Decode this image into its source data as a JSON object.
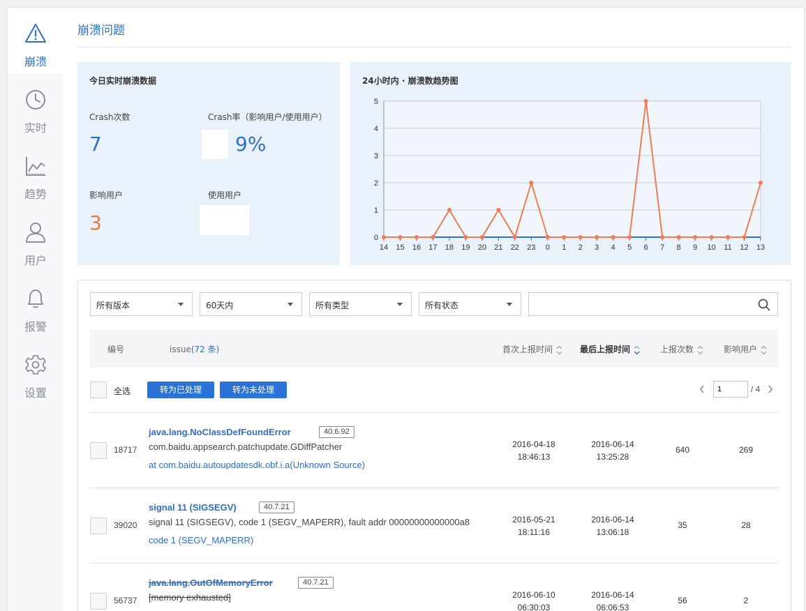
{
  "sidebar": {
    "items": [
      {
        "label": "崩溃",
        "icon": "warning-icon",
        "active": true
      },
      {
        "label": "实时",
        "icon": "clock-icon"
      },
      {
        "label": "趋势",
        "icon": "trend-chart-icon"
      },
      {
        "label": "用户",
        "icon": "user-icon"
      },
      {
        "label": "报警",
        "icon": "bell-icon"
      },
      {
        "label": "设置",
        "icon": "gear-icon"
      }
    ]
  },
  "page": {
    "title": "崩溃问题"
  },
  "today": {
    "title": "今日实时崩溃数据",
    "crash_count_label": "Crash次数",
    "crash_count": "7",
    "crash_rate_label": "Crash率（影响用户/使用用户）",
    "crash_rate": "9%",
    "affected_users_label": "影响用户",
    "affected_users": "3",
    "active_users_label": "使用用户"
  },
  "chart_data": {
    "type": "line",
    "title": "24小时内 · 崩溃数趋势图",
    "categories": [
      "14",
      "15",
      "16",
      "17",
      "18",
      "19",
      "20",
      "21",
      "22",
      "23",
      "0",
      "1",
      "2",
      "3",
      "4",
      "5",
      "6",
      "7",
      "8",
      "9",
      "10",
      "11",
      "12",
      "13"
    ],
    "values": [
      0,
      0,
      0,
      0,
      1,
      0,
      0,
      1,
      0,
      2,
      0,
      0,
      0,
      0,
      0,
      0,
      5,
      0,
      0,
      0,
      0,
      0,
      0,
      2
    ],
    "ylim": [
      0,
      5
    ],
    "yticks": [
      "0",
      "1",
      "2",
      "3",
      "4",
      "5"
    ],
    "grid": true,
    "line_color": "#f37b52",
    "axis_color": "#2f6fcd"
  },
  "filters": {
    "version": "所有版本",
    "range": "60天内",
    "type": "所有类型",
    "status": "所有状态",
    "search_value": ""
  },
  "table": {
    "headers": {
      "id": "编号",
      "issue": "issue",
      "issue_count": "(72 条)",
      "first_time": "首次上报时间",
      "last_time": "最后上报时间",
      "reports": "上报次数",
      "users": "影响用户"
    },
    "select_all": "全选",
    "mark_processed": "转为已处理",
    "mark_unprocessed": "转为未处理",
    "page_current": "1",
    "page_total": "/ 4",
    "rows": [
      {
        "id": "18717",
        "title": "java.lang.NoClassDefFoundError",
        "version": "40.6.92",
        "subtitle": "com.baidu.appsearch.patchupdate.GDiffPatcher",
        "link": "at com.baidu.autoupdatesdk.obf.i.a(Unknown Source)",
        "first_date": "2016-04-18",
        "first_time": "18:46:13",
        "last_date": "2016-06-14",
        "last_time": "13:25:28",
        "reports": "640",
        "users": "269"
      },
      {
        "id": "39020",
        "title": "signal 11 (SIGSEGV)",
        "version": "40.7.21",
        "subtitle": "signal 11 (SIGSEGV), code 1 (SEGV_MAPERR), fault addr 00000000000000a8",
        "link": "code 1 (SEGV_MAPERR)",
        "first_date": "2016-05-21",
        "first_time": "18:11:16",
        "last_date": "2016-06-14",
        "last_time": "13:06:18",
        "reports": "35",
        "users": "28"
      },
      {
        "id": "56737",
        "title": "java.lang.OutOfMemoryError",
        "version": "40.7.21",
        "subtitle": "[memory exhausted]",
        "link": "",
        "first_date": "2016-06-10",
        "first_time": "06:30:03",
        "last_date": "2016-06-14",
        "last_time": "06:06:53",
        "reports": "56",
        "users": "2"
      }
    ]
  }
}
